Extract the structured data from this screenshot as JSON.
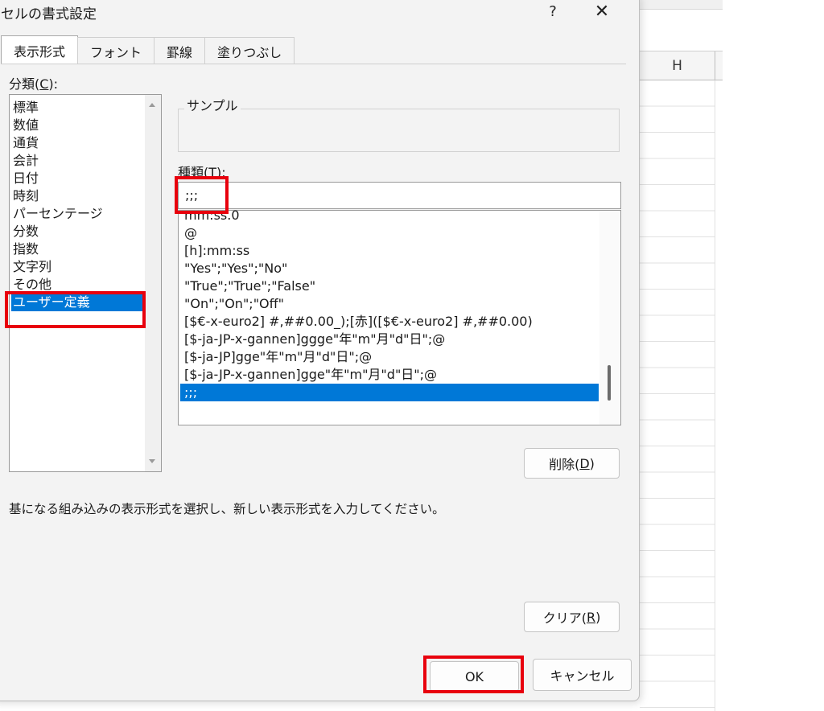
{
  "dialog": {
    "title": "セルの書式設定",
    "help_label": "?",
    "close_label": "✕"
  },
  "tabs": [
    {
      "label": "表示形式",
      "active": true
    },
    {
      "label": "フォント",
      "active": false
    },
    {
      "label": "罫線",
      "active": false
    },
    {
      "label": "塗りつぶし",
      "active": false
    }
  ],
  "category": {
    "label_prefix": "分類(",
    "label_key": "C",
    "label_suffix": "):",
    "items": [
      "標準",
      "数値",
      "通貨",
      "会計",
      "日付",
      "時刻",
      "パーセンテージ",
      "分数",
      "指数",
      "文字列",
      "その他",
      "ユーザー定義"
    ],
    "selected": "ユーザー定義"
  },
  "sample": {
    "label": "サンプル",
    "value": ""
  },
  "type": {
    "label_prefix": "種類(",
    "label_key": "T",
    "label_suffix": "):",
    "value": ";;;",
    "formats": [
      "mm:ss.0",
      "@",
      "[h]:mm:ss",
      "\"Yes\";\"Yes\";\"No\"",
      "\"True\";\"True\";\"False\"",
      "\"On\";\"On\";\"Off\"",
      "[$€-x-euro2] #,##0.00_);[赤]([$€-x-euro2] #,##0.00)",
      "[$-ja-JP-x-gannen]ggge\"年\"m\"月\"d\"日\";@",
      "[$-ja-JP]gge\"年\"m\"月\"d\"日\";@",
      "[$-ja-JP-x-gannen]gge\"年\"m\"月\"d\"日\";@",
      ";;;"
    ],
    "selected": ";;;"
  },
  "buttons": {
    "delete_prefix": "削除(",
    "delete_key": "D",
    "delete_suffix": ")",
    "clear_prefix": "クリア(",
    "clear_key": "R",
    "clear_suffix": ")",
    "ok": "OK",
    "cancel": "キャンセル"
  },
  "hint": "基になる組み込みの表示形式を選択し、新しい表示形式を入力してください。",
  "sheet": {
    "column_header": "H"
  },
  "colors": {
    "selection": "#0078d7",
    "highlight": "#e8000d"
  }
}
